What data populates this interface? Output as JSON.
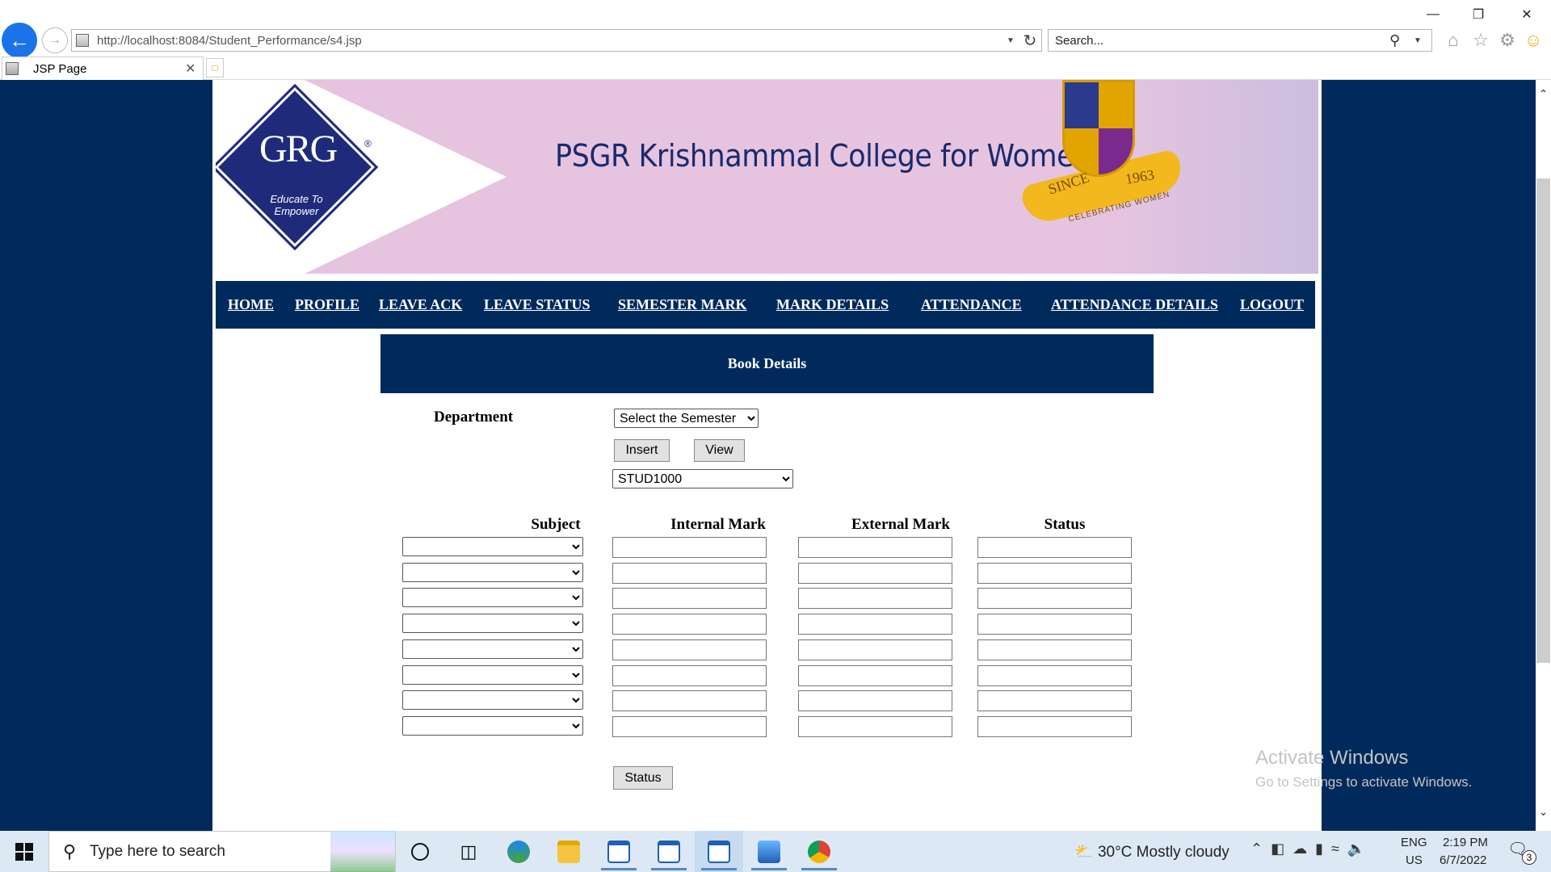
{
  "browser": {
    "url": "http://localhost:8084/Student_Performance/s4.jsp",
    "search_placeholder": "Search...",
    "tab_title": "JSP Page"
  },
  "header": {
    "logo_text": "GRG",
    "logo_tagline": "Educate To Empower",
    "college_name": "PSGR Krishnammal College for Women",
    "crest_since": "SINCE",
    "crest_year": "1963",
    "crest_motto": "CELEBRATING WOMEN"
  },
  "nav": {
    "items": [
      {
        "label": "HOME"
      },
      {
        "label": "PROFILE"
      },
      {
        "label": "LEAVE ACK"
      },
      {
        "label": "LEAVE STATUS"
      },
      {
        "label": "SEMESTER MARK"
      },
      {
        "label": "MARK DETAILS"
      },
      {
        "label": "ATTENDANCE"
      },
      {
        "label": "ATTENDANCE DETAILS"
      },
      {
        "label": "LOGOUT"
      }
    ]
  },
  "form": {
    "title": "Book Details",
    "department_label": "Department",
    "semester_select": "Select the Semester",
    "insert_button": "Insert",
    "view_button": "View",
    "student_select": "STUD1000",
    "columns": {
      "subject": "Subject",
      "internal": "Internal Mark",
      "external": "External Mark",
      "status": "Status"
    },
    "row_count": 8,
    "status_button": "Status"
  },
  "watermark": {
    "line1": "Activate Windows",
    "line2": "Go to Settings to activate Windows."
  },
  "taskbar": {
    "search_placeholder": "Type here to search",
    "weather": "30°C  Mostly cloudy",
    "lang_line1": "ENG",
    "lang_line2": "US",
    "time": "2:19 PM",
    "date": "6/7/2022",
    "notification_count": "3"
  },
  "colors": {
    "navy": "#002a5c",
    "banner_pink": "#e6c4e0",
    "logo_blue": "#1f2b7a"
  }
}
